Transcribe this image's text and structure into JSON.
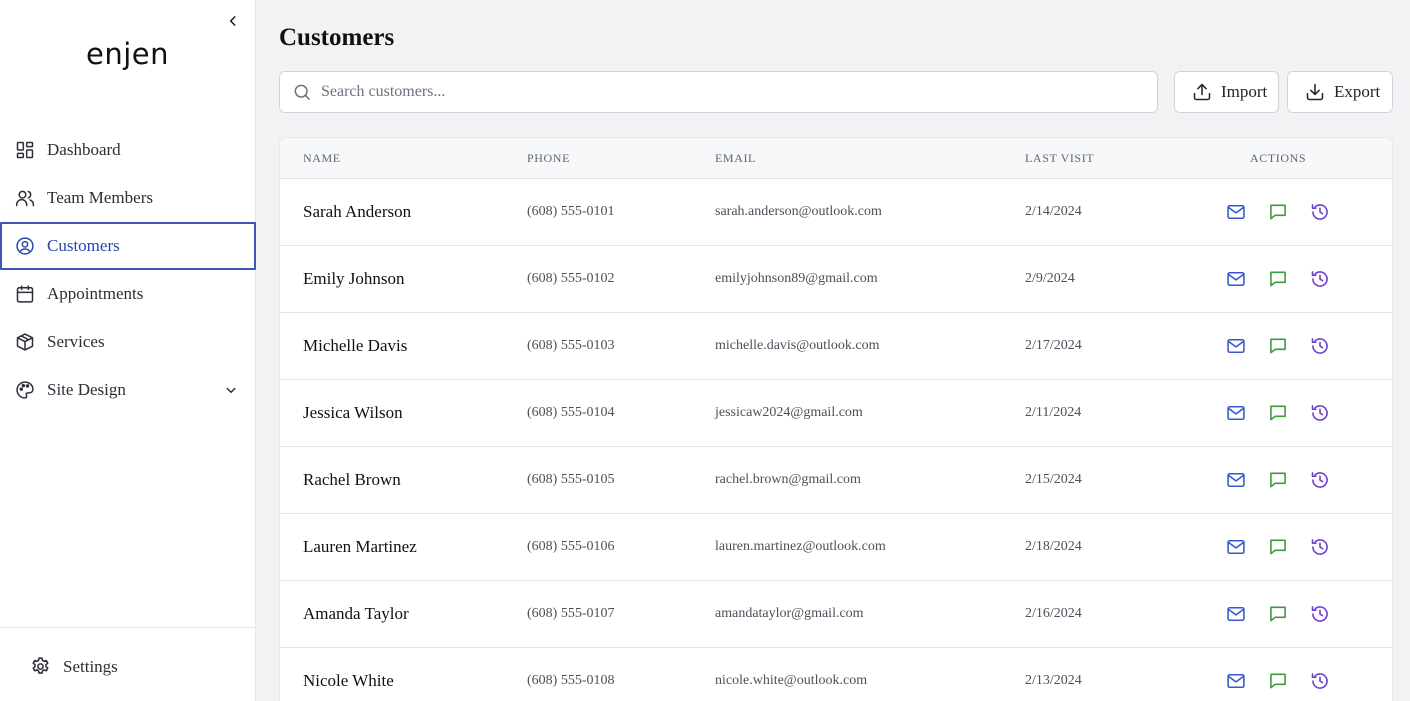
{
  "sidebar": {
    "logo_text": "enjen",
    "collapse_icon": "chevron-left-icon",
    "nav": [
      {
        "label": "Dashboard",
        "icon": "dashboard-icon"
      },
      {
        "label": "Team Members",
        "icon": "users-icon"
      },
      {
        "label": "Customers",
        "icon": "user-circle-icon",
        "active": true
      },
      {
        "label": "Appointments",
        "icon": "calendar-icon"
      },
      {
        "label": "Services",
        "icon": "box-icon"
      },
      {
        "label": "Site Design",
        "icon": "palette-icon",
        "has_dropdown": true
      }
    ],
    "footer": {
      "settings_label": "Settings",
      "icon": "gear-icon"
    }
  },
  "header": {
    "title": "Customers",
    "search_placeholder": "Search customers...",
    "search_value": "",
    "import_label": "Import",
    "export_label": "Export"
  },
  "table": {
    "columns": [
      "NAME",
      "PHONE",
      "EMAIL",
      "LAST VISIT",
      "ACTIONS"
    ],
    "rows": [
      {
        "name": "Sarah Anderson",
        "phone": "(608) 555-0101",
        "email": "sarah.anderson@outlook.com",
        "last_visit": "2/14/2024"
      },
      {
        "name": "Emily Johnson",
        "phone": "(608) 555-0102",
        "email": "emilyjohnson89@gmail.com",
        "last_visit": "2/9/2024"
      },
      {
        "name": "Michelle Davis",
        "phone": "(608) 555-0103",
        "email": "michelle.davis@outlook.com",
        "last_visit": "2/17/2024"
      },
      {
        "name": "Jessica Wilson",
        "phone": "(608) 555-0104",
        "email": "jessicaw2024@gmail.com",
        "last_visit": "2/11/2024"
      },
      {
        "name": "Rachel Brown",
        "phone": "(608) 555-0105",
        "email": "rachel.brown@gmail.com",
        "last_visit": "2/15/2024"
      },
      {
        "name": "Lauren Martinez",
        "phone": "(608) 555-0106",
        "email": "lauren.martinez@outlook.com",
        "last_visit": "2/18/2024"
      },
      {
        "name": "Amanda Taylor",
        "phone": "(608) 555-0107",
        "email": "amandataylor@gmail.com",
        "last_visit": "2/16/2024"
      },
      {
        "name": "Nicole White",
        "phone": "(608) 555-0108",
        "email": "nicole.white@outlook.com",
        "last_visit": "2/13/2024"
      }
    ],
    "row_actions": [
      "mail-icon",
      "message-icon",
      "history-icon"
    ]
  },
  "colors": {
    "accent": "#2c44ad",
    "mail": "#3559d1",
    "message": "#3f9a3f",
    "history": "#6d3fd0"
  }
}
